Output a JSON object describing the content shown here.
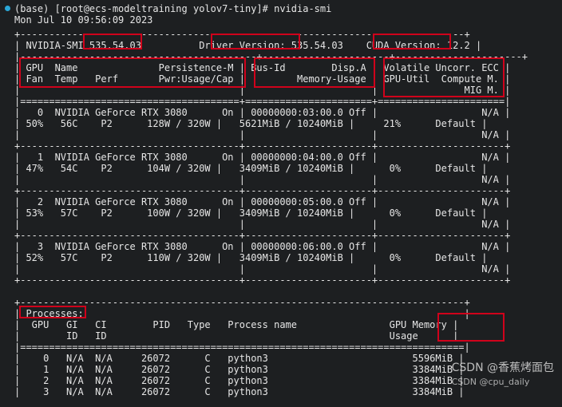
{
  "header": {
    "prompt": "(base) [root@ecs-modeltraining yolov7-tiny]# nvidia-smi",
    "timestamp": "Mon Jul 10 09:56:09 2023"
  },
  "lines": [
    "+-----------------------------------------------------------------------------+",
    "| NVIDIA-SMI 535.54.03          Driver Version: 535.54.03    CUDA Version: 12.2 |",
    "|-----------------------------------------+----------------------+----------------------+",
    "| GPU  Name              Persistence-M | Bus-Id        Disp.A | Volatile Uncorr. ECC |",
    "| Fan  Temp   Perf       Pwr:Usage/Cap |         Memory-Usage | GPU-Util  Compute M. |",
    "|                                      |                      |               MIG M. |",
    "|======================================+======================+======================|",
    "|   0  NVIDIA GeForce RTX 3080      On | 00000000:03:00.0 Off |                  N/A |",
    "| 50%   56C    P2      128W / 320W |   5621MiB / 10240MiB |     21%      Default |",
    "|                                      |                      |                  N/A |",
    "+--------------------------------------+----------------------+----------------------+",
    "|   1  NVIDIA GeForce RTX 3080      On | 00000000:04:00.0 Off |                  N/A |",
    "| 47%   54C    P2      104W / 320W |   3409MiB / 10240MiB |      0%      Default |",
    "|                                      |                      |                  N/A |",
    "+--------------------------------------+----------------------+----------------------+",
    "|   2  NVIDIA GeForce RTX 3080      On | 00000000:05:00.0 Off |                  N/A |",
    "| 53%   57C    P2      100W / 320W |   3409MiB / 10240MiB |      0%      Default |",
    "|                                      |                      |                  N/A |",
    "+--------------------------------------+----------------------+----------------------+",
    "|   3  NVIDIA GeForce RTX 3080      On | 00000000:06:00.0 Off |                  N/A |",
    "| 52%   57C    P2      110W / 320W |   3409MiB / 10240MiB |      0%      Default |",
    "|                                      |                      |                  N/A |",
    "+--------------------------------------+----------------------+----------------------+",
    "",
    "+-----------------------------------------------------------------------------+",
    "| Processes:                                                                  |",
    "|  GPU   GI   CI        PID   Type   Process name                GPU Memory |",
    "|        ID   ID                                                 Usage      |",
    "|=============================================================================|",
    "|    0   N/A  N/A     26072      C   python3                         5596MiB |",
    "|    1   N/A  N/A     26072      C   python3                         3384MiB |",
    "|    2   N/A  N/A     26072      C   python3                         3384MiB |",
    "|    3   N/A  N/A     26072      C   python3                         3384MiB |"
  ],
  "watermark": {
    "text": "CSDN @香蕉烤面包",
    "sub": "CSDN @cpu_daily"
  },
  "colors": {
    "highlight": "#d0021b",
    "background": "#1d1f21",
    "text": "#e6e6e6",
    "prompt_dot": "#2aa6d6"
  }
}
